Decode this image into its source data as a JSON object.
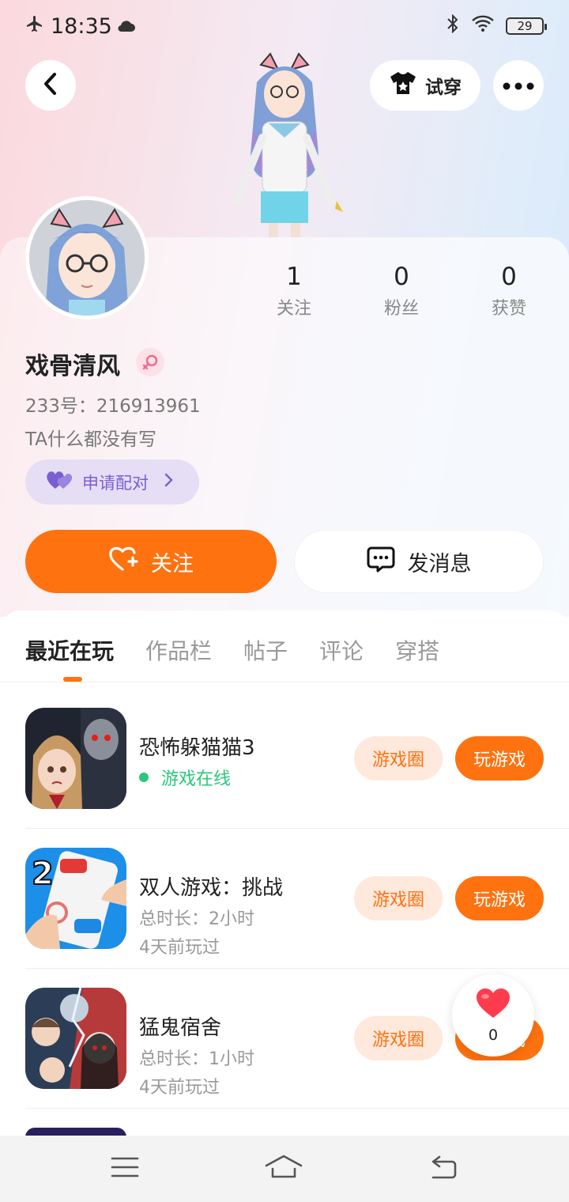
{
  "status_bar": {
    "time": "18:35",
    "battery": "29"
  },
  "header": {
    "try_on_label": "试穿"
  },
  "stats": [
    {
      "value": "1",
      "label": "关注"
    },
    {
      "value": "0",
      "label": "粉丝"
    },
    {
      "value": "0",
      "label": "获赞"
    }
  ],
  "profile": {
    "nickname": "戏骨清风",
    "uid": "233号：216913961",
    "bio": "TA什么都没有写",
    "pair_label": "申请配对"
  },
  "actions": {
    "follow_label": "关注",
    "message_label": "发消息"
  },
  "tabs": [
    "最近在玩",
    "作品栏",
    "帖子",
    "评论",
    "穿搭"
  ],
  "games": [
    {
      "title": "恐怖躲猫猫3",
      "status": "游戏在线",
      "circle_label": "游戏圈",
      "play_label": "玩游戏"
    },
    {
      "title": "双人游戏：挑战",
      "duration": "总时长：2小时",
      "last_played": "4天前玩过",
      "circle_label": "游戏圈",
      "play_label": "玩游戏"
    },
    {
      "title": "猛鬼宿舍",
      "duration": "总时长：1小时",
      "last_played": "4天前玩过",
      "circle_label": "游戏圈",
      "play_label": "玩游戏"
    }
  ],
  "like_float": {
    "count": "0"
  },
  "colors": {
    "accent": "#ff7210",
    "online": "#2bc77b",
    "pair": "#7a5fd0"
  }
}
